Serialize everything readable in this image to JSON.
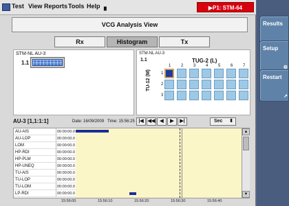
{
  "menu": {
    "items": [
      "Test",
      "View",
      "Reports",
      "Tools",
      "Help"
    ]
  },
  "port_badge": "▶P1: STM-64",
  "title": "VCG Analysis View",
  "tabs": [
    {
      "label": "Rx",
      "active": false
    },
    {
      "label": "Histogram",
      "active": true
    },
    {
      "label": "Tx",
      "active": false
    }
  ],
  "left_panel": {
    "title": "STM-NL AU-3",
    "index": "1.1"
  },
  "right_panel": {
    "title": "STM-NL AU-3",
    "index": "1.1",
    "tug_label": "TUG-2 (L)",
    "tu_label": "TU-12 (M)",
    "columns": [
      "1",
      "2",
      "3",
      "4",
      "5",
      "6",
      "7"
    ],
    "rows": [
      "1",
      "2",
      "3"
    ],
    "selected": {
      "row": 0,
      "col": 0
    }
  },
  "mid": {
    "au_label": "AU-3 [1,1:1:1]",
    "date": "Date: 16/09/2009",
    "time": "Time: 15:56:25",
    "nav": [
      "|◀",
      "◀◀",
      "◀",
      "▶",
      "▶|"
    ],
    "interval": "Sec"
  },
  "alarms": [
    {
      "label": "AU-AIS",
      "time": "00:00:00.0"
    },
    {
      "label": "AU-LOP",
      "time": "00:00:00.0"
    },
    {
      "label": "LOM",
      "time": "00:00:00.0"
    },
    {
      "label": "HP-RDI",
      "time": "00:00:00.0"
    },
    {
      "label": "HP-PLM",
      "time": "00:00:00.0"
    },
    {
      "label": "HP-UNEQ",
      "time": "00:00:00.0"
    },
    {
      "label": "TU-AIS",
      "time": "00:00:00.0"
    },
    {
      "label": "TU-LOP",
      "time": "00:00:00.0"
    },
    {
      "label": "TU-LOM",
      "time": "00:00:00.0"
    },
    {
      "label": "LP-RDI",
      "time": "00:00:00.0"
    }
  ],
  "axis_ticks": [
    "15:56:00",
    "15:56:10",
    "15:56:20",
    "15:56:30",
    "15:56:40"
  ],
  "side": {
    "buttons": [
      {
        "label": "Results",
        "sub": "- R"
      },
      {
        "label": "Setup",
        "sub": "⚙"
      },
      {
        "label": "Restart",
        "sub": "↗"
      }
    ]
  },
  "colors": {
    "accent": "#d9000f",
    "selected_cell": "#1c3aa0",
    "cell": "#9ec9e6",
    "timeline_bg": "#fbf6c8",
    "event": "#1c2c9c"
  }
}
